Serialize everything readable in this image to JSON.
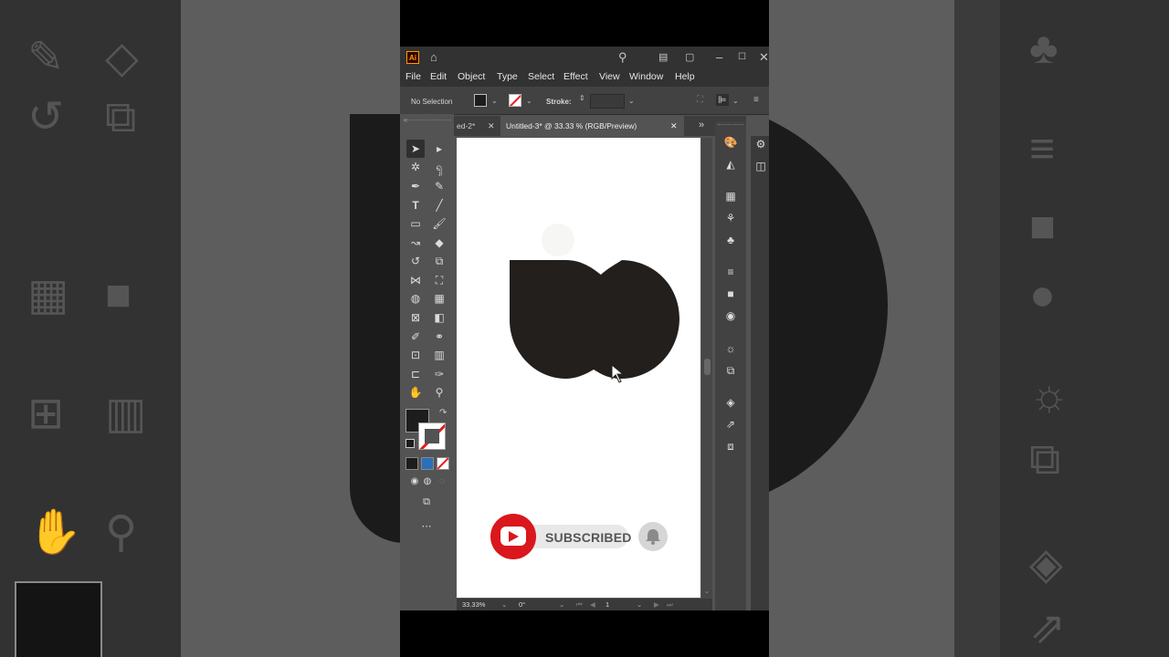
{
  "window": {
    "app_icon": "Ai",
    "icons": [
      "home-icon",
      "search-icon",
      "workspace-icon",
      "arrange-icon",
      "minimize-icon",
      "maximize-icon",
      "close-icon"
    ]
  },
  "menu": [
    "File",
    "Edit",
    "Object",
    "Type",
    "Select",
    "Effect",
    "View",
    "Window",
    "Help"
  ],
  "control_bar": {
    "selection": "No Selection",
    "stroke_label": "Stroke:",
    "fill_color": "#1d1d1d",
    "stroke_color": "none"
  },
  "tabs": [
    {
      "label": "ed-2*",
      "active": false
    },
    {
      "label": "Untitled-3* @ 33.33 % (RGB/Preview)",
      "active": true
    }
  ],
  "status": {
    "zoom": "33.33%",
    "rotation": "0°",
    "artboard": "1"
  },
  "artwork": {
    "shape_color": "#231f1c"
  },
  "overlay": {
    "subscribe_label": "SUBSCRIBED"
  },
  "colors": {
    "youtube_red": "#d9171c",
    "panel_dark": "#323232",
    "panel_mid": "#535353"
  }
}
